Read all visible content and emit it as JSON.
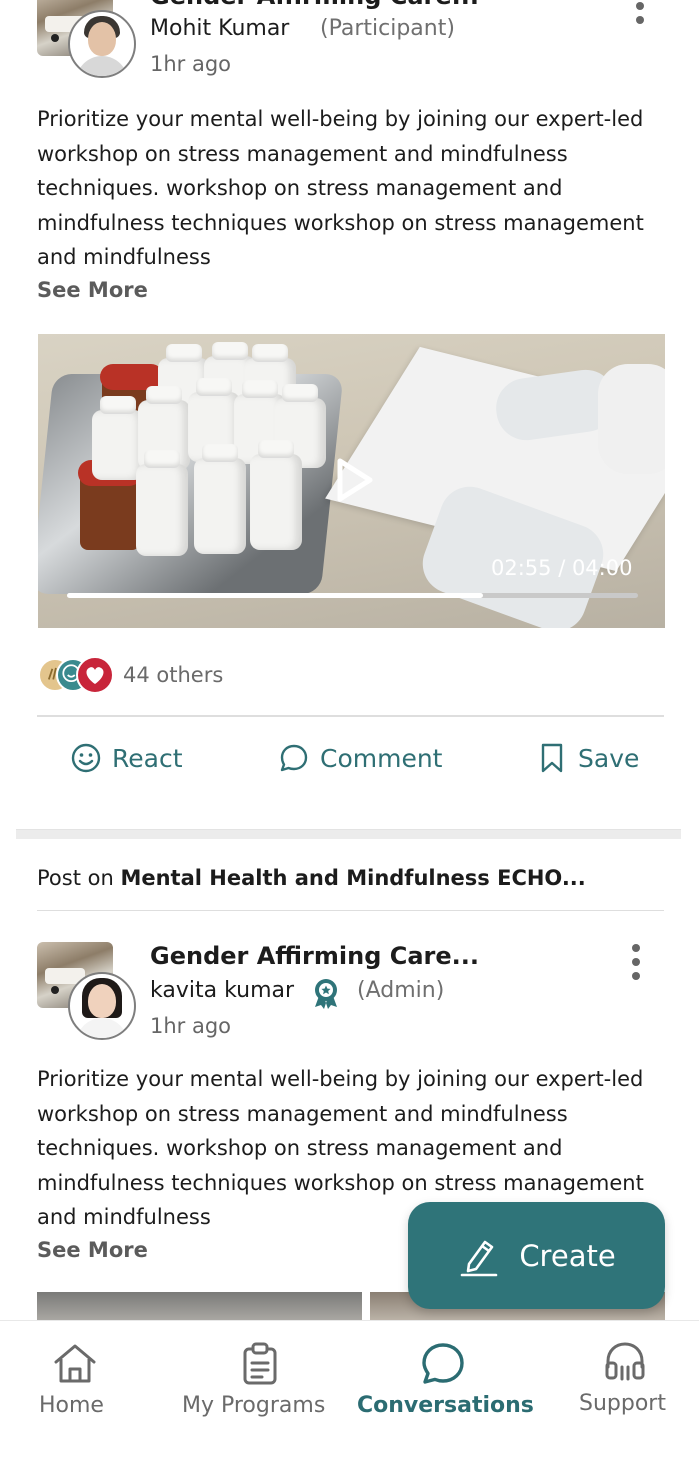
{
  "post1": {
    "title": "Gender Affirming Care...",
    "author": "Mohit Kumar",
    "role": "(Participant)",
    "time": "1hr ago",
    "body": "Prioritize your mental well-being by joining our expert-led workshop on stress management and mindfulness techniques.  workshop on stress management and mindfulness techniques workshop on stress management and mindfulness",
    "see_more": "See More",
    "video": {
      "timecode": "02:55 / 04:00",
      "progress": 0.7292
    },
    "reactions": {
      "icons": [
        "clap-icon",
        "smile-icon",
        "heart-icon"
      ],
      "others": "44 others"
    },
    "actions": {
      "react": "React",
      "comment": "Comment",
      "save": "Save"
    }
  },
  "post2": {
    "post_on_prefix": "Post on",
    "community": "Mental Health and Mindfulness ECHO...",
    "title": "Gender Affirming Care...",
    "author": "kavita kumar",
    "role": "(Admin)",
    "time": "1hr ago",
    "body": "Prioritize your mental well-being by joining our expert-led workshop on stress management and mindfulness techniques.  workshop on stress management and mindfulness techniques workshop on stress management and mindfulness",
    "see_more": "See More"
  },
  "fab": {
    "label": "Create"
  },
  "nav": {
    "home": "Home",
    "programs": "My Programs",
    "conversations": "Conversations",
    "support": "Support",
    "active": "conversations"
  },
  "colors": {
    "accent": "#2f7479",
    "accent_text": "#2b6c72",
    "heart": "#c8253a"
  }
}
